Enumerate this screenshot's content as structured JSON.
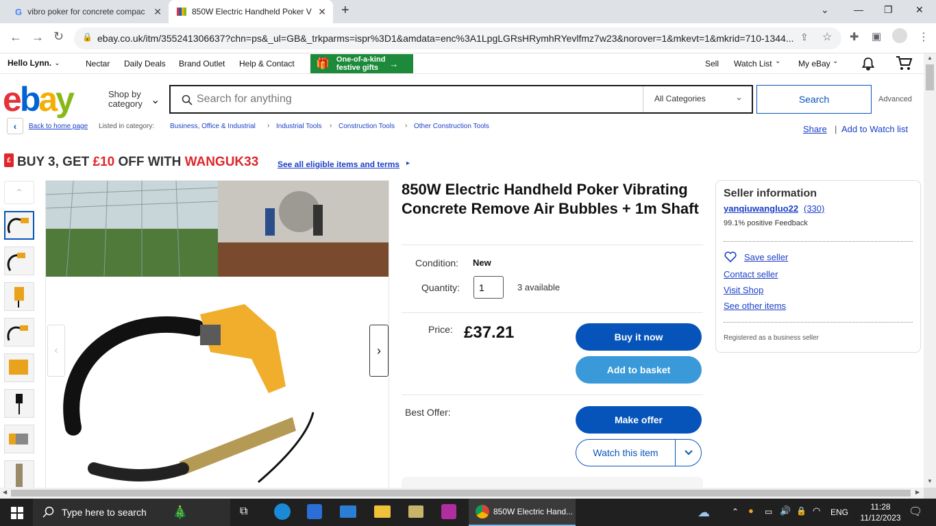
{
  "browser": {
    "tabs": [
      {
        "title": "vibro poker for concrete compac"
      },
      {
        "title": "850W Electric Handheld Poker V"
      }
    ],
    "url": "ebay.co.uk/itm/355241306637?chn=ps&_ul=GB&_trkparms=ispr%3D1&amdata=enc%3A1LpgLGRsHRymhRYevlfmz7w23&norover=1&mkevt=1&mkrid=710-1344..."
  },
  "header": {
    "greeting": "Hello Lynn.",
    "links": [
      "Nectar",
      "Daily Deals",
      "Brand Outlet",
      "Help & Contact"
    ],
    "promo_line1": "One-of-a-kind",
    "promo_line2": "festive gifts",
    "right_links": [
      "Sell",
      "Watch List",
      "My eBay"
    ]
  },
  "search": {
    "logo": "ebay",
    "shop_by": "Shop by",
    "category": "category",
    "placeholder": "Search for anything",
    "all_categories": "All Categories",
    "button": "Search",
    "advanced": "Advanced"
  },
  "breadcrumb": {
    "back": "Back to home page",
    "listed": "Listed in category:",
    "items": [
      "Business, Office & Industrial",
      "Industrial Tools",
      "Construction Tools",
      "Other Construction Tools"
    ],
    "share": "Share",
    "watch": "Add to Watch list"
  },
  "promo": {
    "text1": "BUY 3, GET ",
    "amount": "£10",
    "text2": " OFF WITH ",
    "code": "WANGUK33",
    "link": "See all eligible items and terms"
  },
  "product": {
    "title": "850W Electric Handheld Poker Vibrating Concrete Remove Air Bubbles + 1m Shaft",
    "condition_label": "Condition:",
    "condition": "New",
    "quantity_label": "Quantity:",
    "quantity": "1",
    "available": "3 available",
    "price_label": "Price:",
    "price": "£37.21",
    "buy_now": "Buy it now",
    "add_basket": "Add to basket",
    "best_offer": "Best Offer:",
    "make_offer": "Make offer",
    "watch": "Watch this item"
  },
  "seller": {
    "heading": "Seller information",
    "name": "yanqiuwangluo22",
    "score": "(330)",
    "feedback": "99.1% positive Feedback",
    "save": "Save seller",
    "contact": "Contact seller",
    "visit": "Visit Shop",
    "other": "See other items",
    "registered": "Registered as a business seller"
  },
  "taskbar": {
    "search": "Type here to search",
    "app": "850W Electric Hand...",
    "lang": "ENG",
    "time": "11:28",
    "date": "11/12/2023"
  },
  "colors": {
    "ebay_blue": "#0654ba",
    "light_blue": "#3a9ad9",
    "link": "#1a3ec8",
    "promo_red": "#e0262b",
    "promo_green": "#1d8a3b"
  }
}
